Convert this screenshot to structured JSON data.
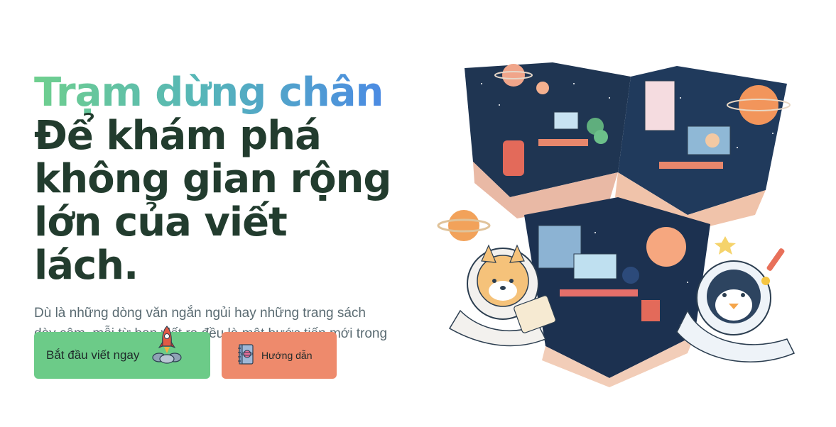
{
  "hero": {
    "headline_accent": "Trạm dừng chân",
    "headline_line1": "Để khám phá",
    "headline_line2": "không gian rộng",
    "headline_line3": "lớn của viết lách.",
    "description": "Dù là những dòng văn ngắn ngủi hay những trang sách dày cộm, mỗi từ bạn viết ra đều là một bước tiến mới trong hành trình của bạn."
  },
  "actions": {
    "start_label": "Bắt đầu viết ngay",
    "guide_label": "Hướng dẫn"
  },
  "icons": {
    "start": "rocket-icon",
    "guide": "notebook-icon"
  },
  "colors": {
    "headline_dark": "#223c2e",
    "gradient_start": "#6fcf8e",
    "gradient_end": "#4a86e8",
    "primary_button": "#6ccb88",
    "secondary_button": "#ee8a6c",
    "body_text": "#5a6b72"
  }
}
